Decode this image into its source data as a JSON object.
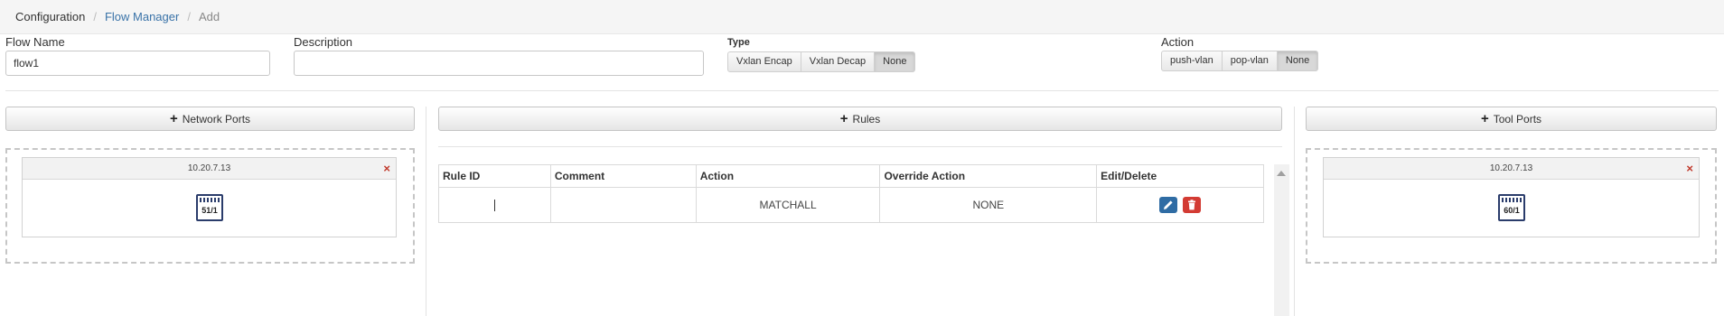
{
  "breadcrumb": {
    "root": "Configuration",
    "section": "Flow Manager",
    "current": "Add",
    "separator": "/"
  },
  "flow_name": {
    "label": "Flow Name",
    "value": "flow1"
  },
  "description": {
    "label": "Description",
    "value": ""
  },
  "type": {
    "label": "Type",
    "options": [
      "Vxlan Encap",
      "Vxlan Decap",
      "None"
    ],
    "selected": "None"
  },
  "action": {
    "label": "Action",
    "options": [
      "push-vlan",
      "pop-vlan",
      "None"
    ],
    "selected": "None"
  },
  "network_ports": {
    "button_label": "Network Ports",
    "device": {
      "ip": "10.20.7.13",
      "port": "51/1",
      "close": "×"
    }
  },
  "rules": {
    "button_label": "Rules",
    "columns": [
      "Rule ID",
      "Comment",
      "Action",
      "Override Action",
      "Edit/Delete"
    ],
    "rows": [
      {
        "rule_id": "",
        "comment": "",
        "action": "MATCHALL",
        "override_action": "NONE"
      }
    ]
  },
  "tool_ports": {
    "button_label": "Tool Ports",
    "device": {
      "ip": "10.20.7.13",
      "port": "60/1",
      "close": "×"
    }
  },
  "icons": {
    "plus": "plus-icon",
    "edit": "pencil-icon",
    "delete": "trash-icon",
    "port": "network-port-icon",
    "close": "close-icon"
  },
  "colors": {
    "link": "#3a73a8",
    "edit_button": "#2f6ca4",
    "delete_button": "#d33b33",
    "port_icon": "#2a3c6b",
    "close": "#c0392b"
  }
}
